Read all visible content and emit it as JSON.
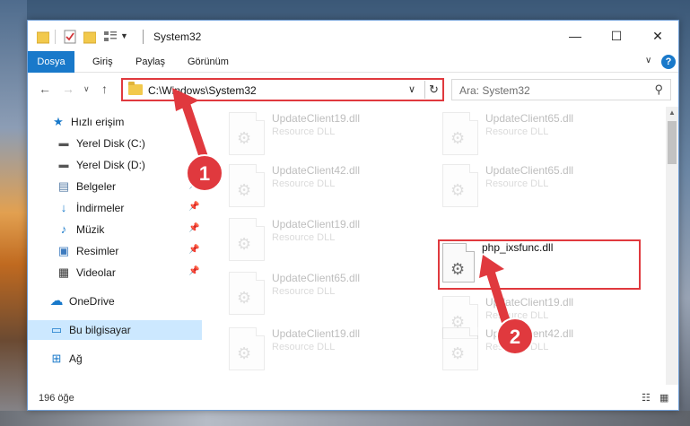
{
  "window": {
    "title": "System32",
    "minimize": "—",
    "maximize": "☐",
    "close": "✕"
  },
  "ribbon": {
    "tabs": [
      "Dosya",
      "Giriş",
      "Paylaş",
      "Görünüm"
    ],
    "help": "?"
  },
  "nav": {
    "address": "C:\\Windows\\System32",
    "search_placeholder": "Ara: System32"
  },
  "sidebar": {
    "items": [
      {
        "label": "Hızlı erişim",
        "icon": "star-icon",
        "pinned": false
      },
      {
        "label": "Yerel Disk (C:)",
        "icon": "drive-icon",
        "pinned": false
      },
      {
        "label": "Yerel Disk (D:)",
        "icon": "drive-icon",
        "pinned": false
      },
      {
        "label": "Belgeler",
        "icon": "documents-icon",
        "pinned": true
      },
      {
        "label": "İndirmeler",
        "icon": "download-icon",
        "pinned": true
      },
      {
        "label": "Müzik",
        "icon": "music-icon",
        "pinned": true
      },
      {
        "label": "Resimler",
        "icon": "pictures-icon",
        "pinned": true
      },
      {
        "label": "Videolar",
        "icon": "videos-icon",
        "pinned": true
      },
      {
        "label": "OneDrive",
        "icon": "cloud-icon",
        "pinned": false
      },
      {
        "label": "Bu bilgisayar",
        "icon": "computer-icon",
        "pinned": false
      },
      {
        "label": "Ağ",
        "icon": "network-icon",
        "pinned": false
      }
    ]
  },
  "files": [
    {
      "name": "UpdateClient19.dll",
      "desc": "Resource DLL",
      "faded": true
    },
    {
      "name": "UpdateClient65.dll",
      "desc": "Resource DLL",
      "faded": true
    },
    {
      "name": "UpdateClient42.dll",
      "desc": "Resource DLL",
      "faded": true
    },
    {
      "name": "UpdateClient65.dll",
      "desc": "Resource DLL",
      "faded": true
    },
    {
      "name": "UpdateClient19.dll",
      "desc": "Resource DLL",
      "faded": true
    },
    {
      "name": "php_ixsfunc.dll",
      "desc": "",
      "faded": false
    },
    {
      "name": "UpdateClient65.dll",
      "desc": "Resource DLL",
      "faded": true
    },
    {
      "name": "UpdateClient19.dll",
      "desc": "Resource DLL",
      "faded": true
    },
    {
      "name": "UpdateClient19.dll",
      "desc": "Resource DLL",
      "faded": true
    },
    {
      "name": "UpdateClient42.dll",
      "desc": "Resource DLL",
      "faded": true
    }
  ],
  "status": {
    "item_count": "196 öğe"
  },
  "annotations": {
    "step1": "1",
    "step2": "2",
    "color": "#e0393e"
  }
}
